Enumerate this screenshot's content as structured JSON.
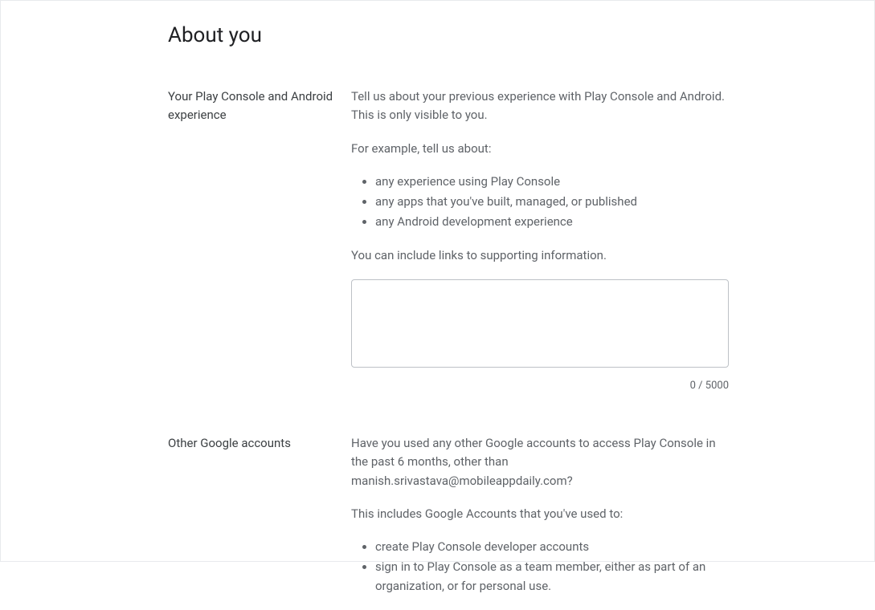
{
  "page": {
    "title": "About you"
  },
  "section1": {
    "label": "Your Play Console and Android experience",
    "intro": "Tell us about your previous experience with Play Console and Android. This is only visible to you.",
    "example_lead": "For example, tell us about:",
    "bullets": [
      "any experience using Play Console",
      "any apps that you've built, managed, or published",
      "any Android development experience"
    ],
    "note": "You can include links to supporting information.",
    "counter": "0 / 5000"
  },
  "section2": {
    "label": "Other Google accounts",
    "intro": "Have you used any other Google accounts to access Play Console in the past 6 months, other than manish.srivastava@mobileappdaily.com?",
    "example_lead": "This includes Google Accounts that you've used to:",
    "bullets": [
      "create Play Console developer accounts",
      "sign in to Play Console as a team member, either as part of an organization, or for personal use."
    ]
  }
}
